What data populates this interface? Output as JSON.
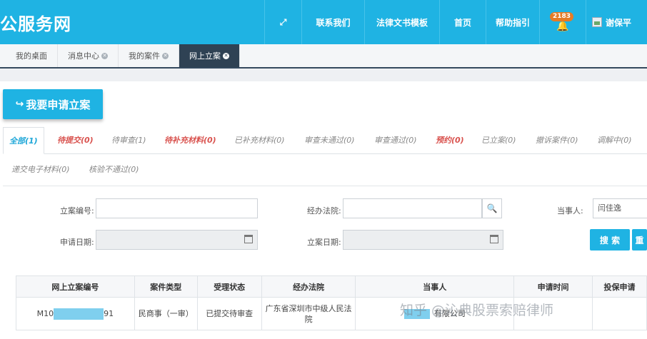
{
  "header": {
    "brand": "公服务网",
    "nav": {
      "expand_icon": "expand-icon",
      "contact": "联系我们",
      "templates": "法律文书模板",
      "home": "首页",
      "help": "帮助指引",
      "bell_count": "2183",
      "user": "谢保平"
    },
    "accent": "#1fb3e3"
  },
  "tabs": [
    {
      "label": "我的桌面"
    },
    {
      "label": "消息中心"
    },
    {
      "label": "我的案件"
    },
    {
      "label": "网上立案"
    }
  ],
  "apply_button": "我要申请立案",
  "status_tabs": {
    "all": "全部(1)",
    "to_submit": "待提交(0)",
    "to_review": "待审查(1)",
    "to_supplement": "待补充材料(0)",
    "supplemented": "已补充材料(0)",
    "review_failed": "审查未通过(0)",
    "review_passed": "审查通过(0)",
    "appointment": "预约(0)",
    "filed": "已立案(0)",
    "withdrawn": "撤诉案件(0)",
    "mediating": "调解中(0)",
    "e_materials": "递交电子材料(0)",
    "verify_failed": "核验不通过(0)"
  },
  "search": {
    "case_no_label": "立案编号:",
    "court_label": "经办法院:",
    "party_label": "当事人:",
    "party_value": "闫佳逸",
    "apply_date_label": "申请日期:",
    "file_date_label": "立案日期:",
    "search_button": "搜 索",
    "reset_button": "重"
  },
  "table": {
    "headers": [
      "网上立案编号",
      "案件类型",
      "受理状态",
      "经办法院",
      "当事人",
      "申请时间",
      "投保申请"
    ],
    "rows": [
      {
        "no_prefix": "M10",
        "no_suffix": "91",
        "type": "民商事（一审）",
        "status": "已提交待审查",
        "court": "广东省深圳市中级人民法院",
        "party": "有限公司",
        "time": "",
        "insurance": ""
      }
    ]
  },
  "watermark": "知乎 @沁典股票索赔律师"
}
